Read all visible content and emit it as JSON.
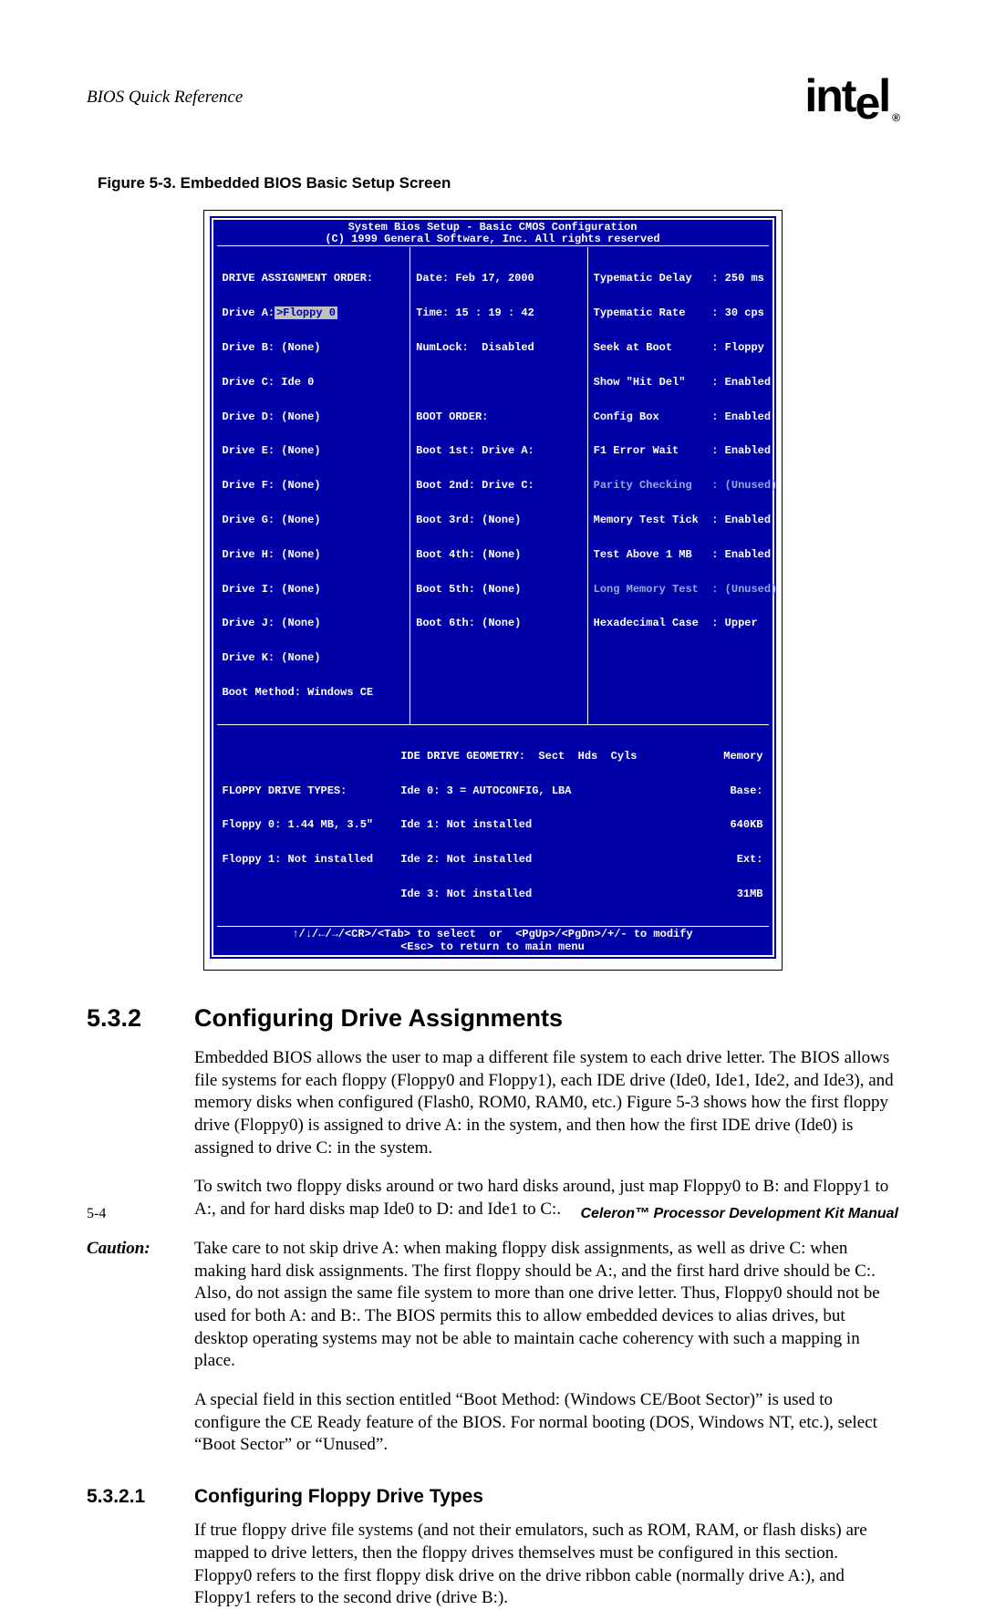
{
  "header": {
    "running": "BIOS Quick Reference",
    "logo": "intel",
    "logo_reg": "®"
  },
  "figure": {
    "caption": "Figure 5-3. Embedded BIOS Basic Setup Screen"
  },
  "bios": {
    "title": "System Bios Setup - Basic CMOS Configuration",
    "copyright": "(C) 1999 General Software, Inc. All rights reserved",
    "col1": {
      "h": "DRIVE ASSIGNMENT ORDER:",
      "a_label": "Drive A:",
      "a_val": ">Floppy 0",
      "b": "Drive B: (None)",
      "c": "Drive C: Ide 0",
      "d": "Drive D: (None)",
      "e": "Drive E: (None)",
      "f": "Drive F: (None)",
      "g": "Drive G: (None)",
      "h2": "Drive H: (None)",
      "i": "Drive I: (None)",
      "j": "Drive J: (None)",
      "k": "Drive K: (None)",
      "boot_method": "Boot Method: Windows CE"
    },
    "col2": {
      "date": "Date: Feb 17, 2000",
      "time": "Time: 15 : 19 : 42",
      "numlock": "NumLock:  Disabled",
      "bo": "BOOT ORDER:",
      "b1": "Boot 1st: Drive A:",
      "b2": "Boot 2nd: Drive C:",
      "b3": "Boot 3rd: (None)",
      "b4": "Boot 4th: (None)",
      "b5": "Boot 5th: (None)",
      "b6": "Boot 6th: (None)"
    },
    "col3": {
      "l1": "Typematic Delay   : 250 ms",
      "l2": "Typematic Rate    : 30 cps",
      "l3": "Seek at Boot      : Floppy",
      "l4": "Show \"Hit Del\"    : Enabled",
      "l5": "Config Box        : Enabled",
      "l6": "F1 Error Wait     : Enabled",
      "l7": "Parity Checking   : (Unused)",
      "l8": "Memory Test Tick  : Enabled",
      "l9": "Test Above 1 MB   : Enabled",
      "l10": "Long Memory Test  : (Unused)",
      "l11": "Hexadecimal Case  : Upper"
    },
    "bot": {
      "l1": "FLOPPY DRIVE TYPES:",
      "l2": "Floppy 0: 1.44 MB, 3.5\"",
      "l3": "Floppy 1: Not installed",
      "m1": "IDE DRIVE GEOMETRY:  Sect  Hds  Cyls",
      "m2": "Ide 0: 3 = AUTOCONFIG, LBA",
      "m3": "Ide 1: Not installed",
      "m4": "Ide 2: Not installed",
      "m5": "Ide 3: Not installed",
      "r1": "Memory",
      "r2": "Base:",
      "r3": "640KB",
      "r4": "Ext:",
      "r5": "31MB"
    },
    "help1": "↑/↓/←/→/<CR>/<Tab> to select  or  <PgUp>/<PgDn>/+/- to modify",
    "help2": "<Esc> to return to main menu"
  },
  "sec": {
    "num": "5.3.2",
    "title": "Configuring Drive Assignments",
    "p1": "Embedded BIOS allows the user to map a different file system to each drive letter. The BIOS allows file systems for each floppy (Floppy0 and Floppy1), each IDE drive (Ide0, Ide1, Ide2, and Ide3), and memory disks when configured (Flash0, ROM0, RAM0, etc.) Figure 5-3 shows how the first floppy drive (Floppy0) is assigned to drive A: in the system, and then how the first IDE drive (Ide0) is assigned to drive C: in the system.",
    "p2": "To switch two floppy disks around or two hard disks around, just map Floppy0 to B: and Floppy1 to A:, and for hard disks map Ide0 to D: and Ide1 to C:."
  },
  "caution": {
    "label": "Caution:",
    "text": "Take care to not skip drive A: when making floppy disk assignments, as well as drive C: when making hard disk assignments. The first floppy should be A:, and the first hard drive should be C:. Also, do not assign the same file system to more than one drive letter. Thus, Floppy0 should not be used for both A: and B:. The BIOS permits this to allow embedded devices to alias drives, but desktop operating systems may not be able to maintain cache coherency with such a mapping in place."
  },
  "after_caution": "A special field in this section entitled “Boot Method: (Windows CE/Boot Sector)” is used to configure the CE Ready feature of the BIOS. For normal booting (DOS, Windows NT, etc.), select “Boot Sector” or “Unused”.",
  "sub": {
    "num": "5.3.2.1",
    "title": "Configuring Floppy Drive Types",
    "p1": "If true floppy drive file systems (and not their emulators, such as ROM, RAM, or flash disks) are mapped to drive letters, then the floppy drives themselves must be configured in this section. Floppy0 refers to the first floppy disk drive on the drive ribbon cable (normally drive A:), and Floppy1 refers to the second drive (drive B:)."
  },
  "footer": {
    "left": "5-4",
    "right": "Celeron™ Processor Development Kit Manual"
  }
}
